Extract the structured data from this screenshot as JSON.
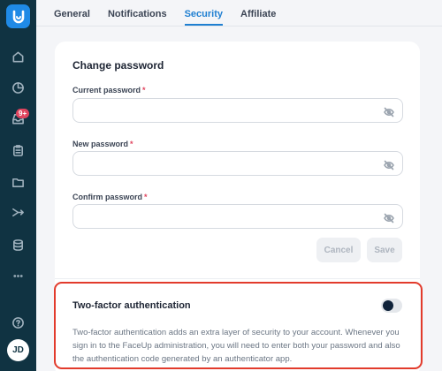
{
  "sidebar": {
    "items": [
      {
        "icon": "home-icon"
      },
      {
        "icon": "pie-chart-icon"
      },
      {
        "icon": "inbox-icon",
        "badge": "9+"
      },
      {
        "icon": "clipboard-icon"
      },
      {
        "icon": "folder-icon"
      },
      {
        "icon": "shuffle-icon"
      },
      {
        "icon": "database-icon"
      },
      {
        "icon": "more-icon"
      }
    ],
    "help_icon": "help-circle-icon",
    "avatar_initials": "JD"
  },
  "tabs": [
    {
      "label": "General",
      "active": false
    },
    {
      "label": "Notifications",
      "active": false
    },
    {
      "label": "Security",
      "active": true
    },
    {
      "label": "Affiliate",
      "active": false
    }
  ],
  "change_password": {
    "title": "Change password",
    "fields": [
      {
        "label": "Current password",
        "required_mark": "*",
        "value": ""
      },
      {
        "label": "New password",
        "required_mark": "*",
        "value": ""
      },
      {
        "label": "Confirm password",
        "required_mark": "*",
        "value": ""
      }
    ],
    "cancel_label": "Cancel",
    "save_label": "Save"
  },
  "two_factor": {
    "title": "Two-factor authentication",
    "enabled": false,
    "description": "Two-factor authentication adds an extra layer of security to your account. Whenever you sign in to the FaceUp administration, you will need to enter both your password and also the authentication code generated by an authenticator app."
  },
  "colors": {
    "sidebar_bg": "#103342",
    "accent": "#1f7fd1",
    "required": "#e0445e",
    "highlight_border": "#e23b2c"
  }
}
